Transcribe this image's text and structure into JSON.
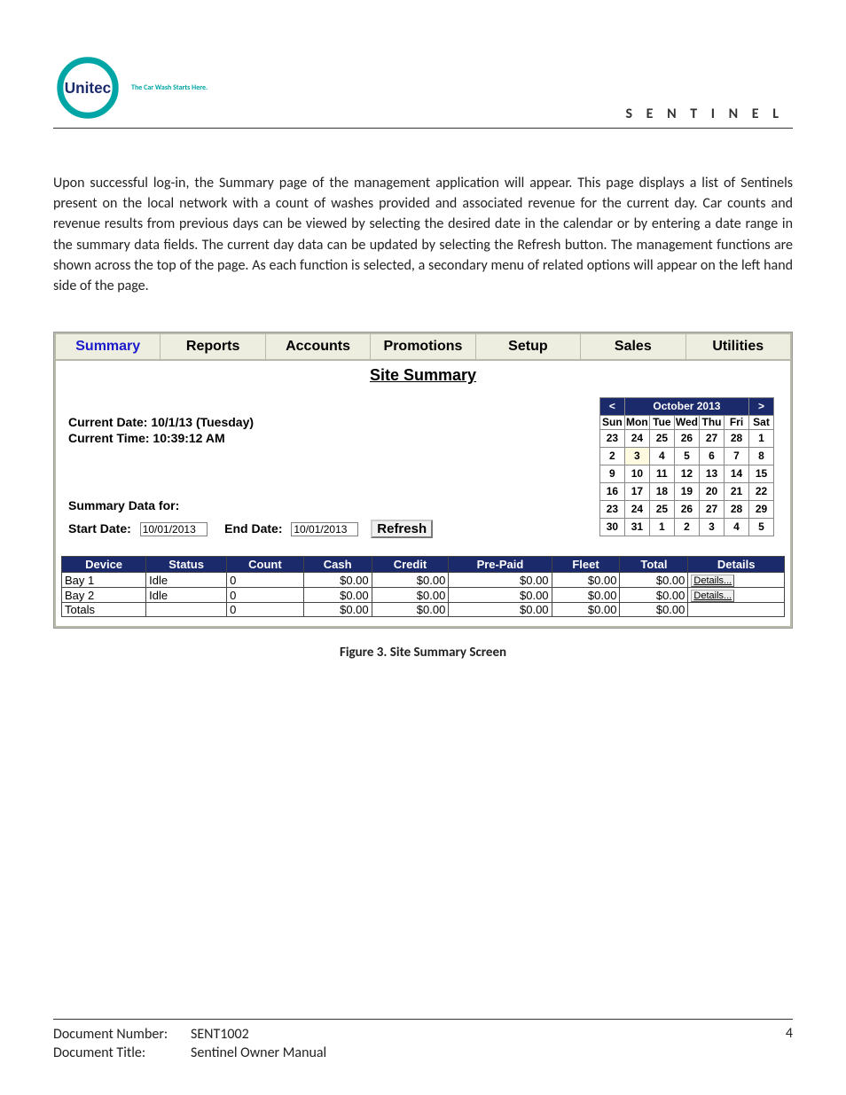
{
  "header": {
    "tagline": "The Car Wash Starts Here.",
    "product_name": "S E N T I N E L"
  },
  "body_text": "Upon successful log-in, the Summary page of the management application will appear. This page displays a list of Sentinels present on the local network with a count of washes provided and associated revenue for the current day. Car counts and revenue results from previous days can be viewed by selecting the desired date in the calendar or by entering a date range in the summary data fields. The current day data can be updated by selecting the Refresh button. The management functions are shown across the top of the page. As each function is selected, a secondary menu of related options will appear on the left hand side of the page.",
  "tabs": [
    "Summary",
    "Reports",
    "Accounts",
    "Promotions",
    "Setup",
    "Sales",
    "Utilities"
  ],
  "active_tab_index": 0,
  "panel": {
    "title": "Site Summary",
    "current_date": "Current Date: 10/1/13 (Tuesday)",
    "current_time": "Current Time: 10:39:12 AM",
    "summary_label": "Summary Data for:",
    "start_label": "Start Date:",
    "start_value": "10/01/2013",
    "end_label": "End Date:",
    "end_value": "10/01/2013",
    "refresh_label": "Refresh"
  },
  "calendar": {
    "month": "October 2013",
    "day_headers": [
      "Sun",
      "Mon",
      "Tue",
      "Wed",
      "Thu",
      "Fri",
      "Sat"
    ],
    "weeks": [
      [
        "23",
        "24",
        "25",
        "26",
        "27",
        "28",
        "1"
      ],
      [
        "2",
        "3",
        "4",
        "5",
        "6",
        "7",
        "8"
      ],
      [
        "9",
        "10",
        "11",
        "12",
        "13",
        "14",
        "15"
      ],
      [
        "16",
        "17",
        "18",
        "19",
        "20",
        "21",
        "22"
      ],
      [
        "23",
        "24",
        "25",
        "26",
        "27",
        "28",
        "29"
      ],
      [
        "30",
        "31",
        "1",
        "2",
        "3",
        "4",
        "5"
      ]
    ],
    "selected": {
      "row": 1,
      "col": 1
    }
  },
  "table": {
    "headers": [
      "Device",
      "Status",
      "Count",
      "Cash",
      "Credit",
      "Pre-Paid",
      "Fleet",
      "Total",
      "Details"
    ],
    "rows": [
      {
        "device": "Bay 1",
        "status": "Idle",
        "count": "0",
        "cash": "$0.00",
        "credit": "$0.00",
        "prepaid": "$0.00",
        "fleet": "$0.00",
        "total": "$0.00",
        "details": "Details..."
      },
      {
        "device": "Bay 2",
        "status": "Idle",
        "count": "0",
        "cash": "$0.00",
        "credit": "$0.00",
        "prepaid": "$0.00",
        "fleet": "$0.00",
        "total": "$0.00",
        "details": "Details..."
      },
      {
        "device": "Totals",
        "status": "",
        "count": "0",
        "cash": "$0.00",
        "credit": "$0.00",
        "prepaid": "$0.00",
        "fleet": "$0.00",
        "total": "$0.00",
        "details": ""
      }
    ]
  },
  "caption": "Figure 3. Site Summary Screen",
  "footer": {
    "doc_num_label": "Document Number:",
    "doc_num": "SENT1002",
    "doc_title_label": "Document Title:",
    "doc_title": "Sentinel Owner Manual",
    "page_num": "4"
  }
}
